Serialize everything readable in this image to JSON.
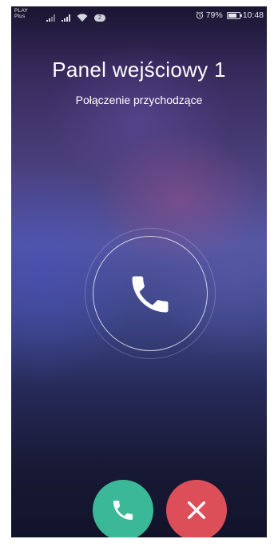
{
  "status_bar": {
    "carrier_line1": "PLAY",
    "carrier_line2": "Plus",
    "notification_count": "2",
    "battery_percent": "79%",
    "time": "10:48",
    "icons": [
      "signal-bars-icon",
      "wifi-icon",
      "alarm-icon",
      "battery-icon"
    ]
  },
  "call": {
    "caller_name": "Panel wejściowy 1",
    "status": "Połączenie przychodzące",
    "center_icon": "phone-handset-icon"
  },
  "actions": {
    "accept_icon": "phone-handset-icon",
    "decline_icon": "close-icon"
  },
  "colors": {
    "accept": "#3bb898",
    "decline": "#dc4f59",
    "text": "#ffffff",
    "background_top": "#1a1530",
    "background_mid": "#5456a0",
    "background_bottom": "#12132a"
  },
  "battery_level": 0.79
}
